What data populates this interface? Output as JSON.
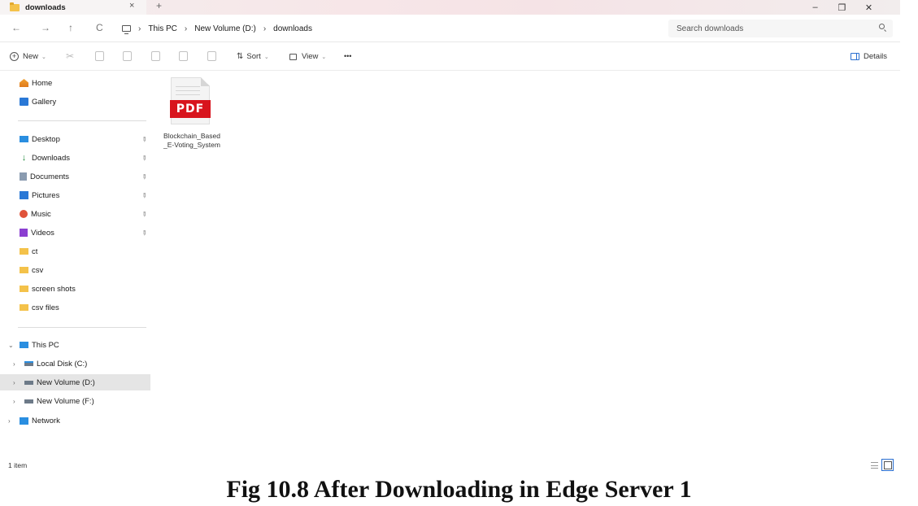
{
  "window": {
    "tab_title": "downloads",
    "tab_close": "×",
    "new_tab": "+",
    "minimize": "–",
    "restore": "❐",
    "close": "✕"
  },
  "nav": {
    "back": "←",
    "forward": "→",
    "up": "↑",
    "refresh": "C",
    "breadcrumb": [
      "This PC",
      "New Volume (D:)",
      "downloads"
    ],
    "search_placeholder": "Search downloads"
  },
  "toolbar": {
    "new_label": "New",
    "sort_label": "Sort",
    "view_label": "View",
    "more_label": "•••",
    "details_label": "Details"
  },
  "sidebar": {
    "quick": [
      {
        "label": "Home",
        "icon": "home-icon"
      },
      {
        "label": "Gallery",
        "icon": "gallery-icon"
      }
    ],
    "pinned": [
      {
        "label": "Desktop",
        "icon": "desktop-icon"
      },
      {
        "label": "Downloads",
        "icon": "download-icon"
      },
      {
        "label": "Documents",
        "icon": "documents-icon"
      },
      {
        "label": "Pictures",
        "icon": "pictures-icon"
      },
      {
        "label": "Music",
        "icon": "music-icon"
      },
      {
        "label": "Videos",
        "icon": "videos-icon"
      }
    ],
    "folders": [
      {
        "label": "ct"
      },
      {
        "label": "csv"
      },
      {
        "label": "screen shots"
      },
      {
        "label": "csv files"
      }
    ],
    "this_pc": {
      "label": "This PC",
      "drives": [
        {
          "label": "Local Disk (C:)"
        },
        {
          "label": "New Volume (D:)",
          "selected": true
        },
        {
          "label": "New Volume (F:)"
        }
      ]
    },
    "network": "Network"
  },
  "files": [
    {
      "name": "Blockchain_Based_E-Voting_System",
      "badge": "PDF"
    }
  ],
  "status": {
    "item_count": "1 item"
  },
  "caption": "Fig 10.8 After Downloading in Edge Server 1",
  "colors": {
    "pdf_red": "#d8141d",
    "folder_yellow": "#f4c24a",
    "accent_blue": "#2a6fd1",
    "selected_bg": "#e5e5e5"
  }
}
